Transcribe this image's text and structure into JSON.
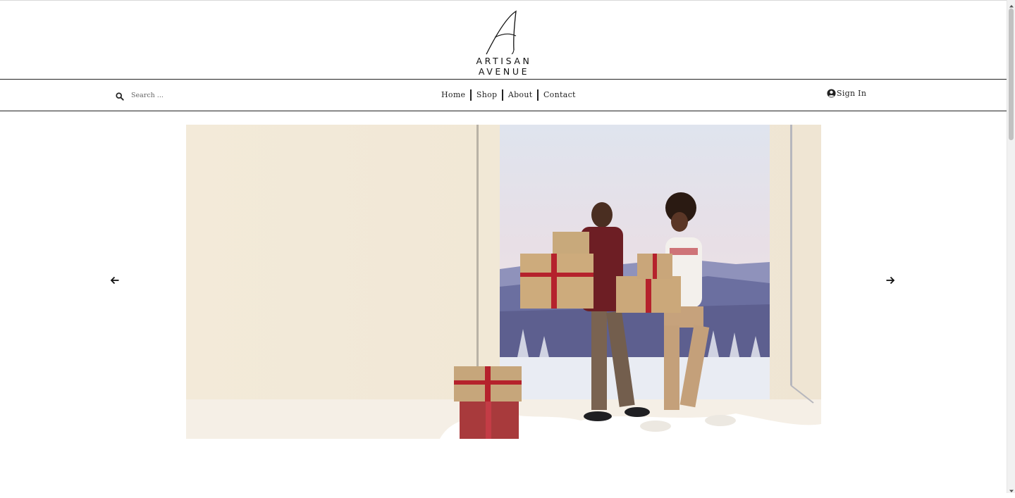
{
  "brand": {
    "name": "ARTISAN AVENUE"
  },
  "search": {
    "placeholder": "Search ...",
    "value": "",
    "icon": "search-icon"
  },
  "nav": {
    "items": [
      {
        "label": "Home"
      },
      {
        "label": "Shop"
      },
      {
        "label": "About"
      },
      {
        "label": "Contact"
      }
    ]
  },
  "account": {
    "signin_label": "Sign In",
    "icon": "user-circle-icon"
  },
  "slider": {
    "prev_icon": "arrow-left-icon",
    "next_icon": "arrow-right-icon",
    "slide_subject": "Couple carrying wrapped gift boxes in a winter studio scene"
  },
  "colors": {
    "text": "#222222",
    "rule": "#222222",
    "hero_background": "#f2e9d9",
    "ribbon": "#b5222c",
    "gift_paper": "#c9a87a"
  }
}
